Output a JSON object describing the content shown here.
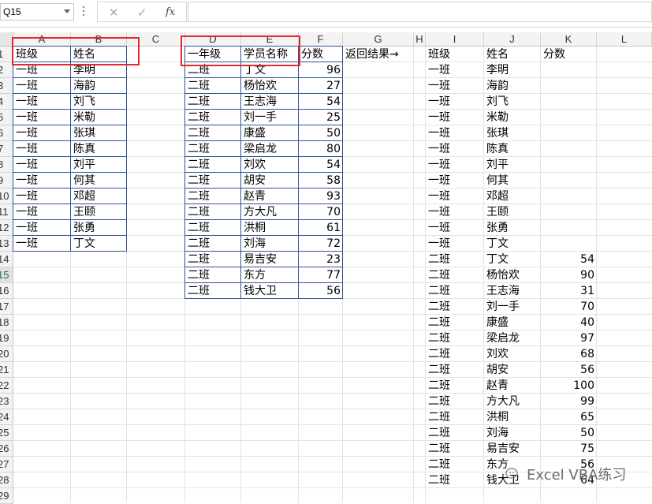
{
  "formula_bar": {
    "name_box": "Q15",
    "cancel": "✕",
    "enter": "✓",
    "fx": "fx",
    "value": ""
  },
  "columns": [
    "A",
    "B",
    "C",
    "D",
    "E",
    "F",
    "G",
    "H",
    "I",
    "J",
    "K",
    "L"
  ],
  "rows": [
    "1",
    "2",
    "3",
    "4",
    "5",
    "6",
    "7",
    "8",
    "9",
    "10",
    "11",
    "12",
    "13",
    "14",
    "15",
    "16",
    "17",
    "18",
    "19",
    "20",
    "21",
    "22",
    "23",
    "24",
    "25",
    "26",
    "27",
    "28",
    "29"
  ],
  "selected_row": "15",
  "table1": {
    "headers": [
      "班级",
      "姓名"
    ],
    "rows": [
      [
        "一班",
        "李明"
      ],
      [
        "一班",
        "海韵"
      ],
      [
        "一班",
        "刘飞"
      ],
      [
        "一班",
        "米勒"
      ],
      [
        "一班",
        "张琪"
      ],
      [
        "一班",
        "陈真"
      ],
      [
        "一班",
        "刘平"
      ],
      [
        "一班",
        "何其"
      ],
      [
        "一班",
        "邓超"
      ],
      [
        "一班",
        "王颐"
      ],
      [
        "一班",
        "张勇"
      ],
      [
        "一班",
        "丁文"
      ]
    ]
  },
  "table2": {
    "headers": [
      "一年级",
      "学员名称",
      "分数"
    ],
    "rows": [
      [
        "二班",
        "丁文",
        "96"
      ],
      [
        "二班",
        "杨怡欢",
        "27"
      ],
      [
        "二班",
        "王志海",
        "54"
      ],
      [
        "二班",
        "刘一手",
        "25"
      ],
      [
        "二班",
        "康盛",
        "50"
      ],
      [
        "二班",
        "梁启龙",
        "80"
      ],
      [
        "二班",
        "刘欢",
        "54"
      ],
      [
        "二班",
        "胡安",
        "58"
      ],
      [
        "二班",
        "赵青",
        "93"
      ],
      [
        "二班",
        "方大凡",
        "70"
      ],
      [
        "二班",
        "洪桐",
        "61"
      ],
      [
        "二班",
        "刘海",
        "72"
      ],
      [
        "二班",
        "易吉安",
        "23"
      ],
      [
        "二班",
        "东方",
        "77"
      ],
      [
        "二班",
        "钱大卫",
        "56"
      ]
    ]
  },
  "result_label": "返回结果→",
  "result": {
    "headers": [
      "班级",
      "姓名",
      "分数"
    ],
    "rows": [
      [
        "一班",
        "李明",
        ""
      ],
      [
        "一班",
        "海韵",
        ""
      ],
      [
        "一班",
        "刘飞",
        ""
      ],
      [
        "一班",
        "米勒",
        ""
      ],
      [
        "一班",
        "张琪",
        ""
      ],
      [
        "一班",
        "陈真",
        ""
      ],
      [
        "一班",
        "刘平",
        ""
      ],
      [
        "一班",
        "何其",
        ""
      ],
      [
        "一班",
        "邓超",
        ""
      ],
      [
        "一班",
        "王颐",
        ""
      ],
      [
        "一班",
        "张勇",
        ""
      ],
      [
        "一班",
        "丁文",
        ""
      ],
      [
        "二班",
        "丁文",
        "54"
      ],
      [
        "二班",
        "杨怡欢",
        "90"
      ],
      [
        "二班",
        "王志海",
        "31"
      ],
      [
        "二班",
        "刘一手",
        "70"
      ],
      [
        "二班",
        "康盛",
        "40"
      ],
      [
        "二班",
        "梁启龙",
        "97"
      ],
      [
        "二班",
        "刘欢",
        "68"
      ],
      [
        "二班",
        "胡安",
        "56"
      ],
      [
        "二班",
        "赵青",
        "100"
      ],
      [
        "二班",
        "方大凡",
        "99"
      ],
      [
        "二班",
        "洪桐",
        "65"
      ],
      [
        "二班",
        "刘海",
        "50"
      ],
      [
        "二班",
        "易吉安",
        "75"
      ],
      [
        "二班",
        "东方",
        "56"
      ],
      [
        "二班",
        "钱大卫",
        "64"
      ]
    ]
  },
  "watermark": "Excel VBA练习",
  "colors": {
    "accent": "#217346",
    "table_border": "#2f5597",
    "highlight": "#e8262a"
  }
}
